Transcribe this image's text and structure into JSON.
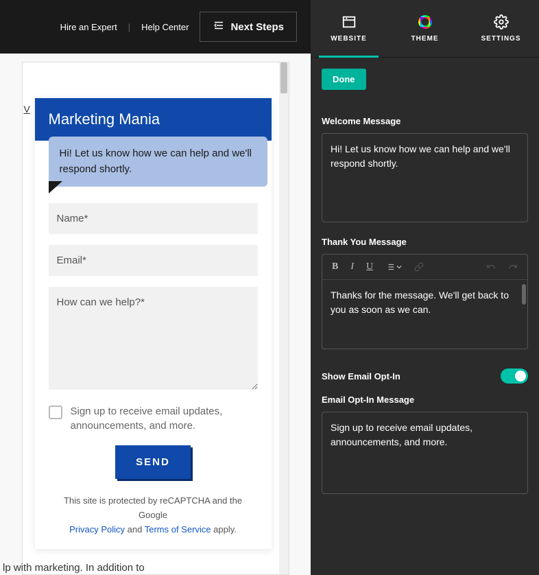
{
  "topbar": {
    "hire_expert": "Hire an Expert",
    "help_center": "Help Center",
    "next_steps": "Next Steps"
  },
  "chat": {
    "title": "Marketing Mania",
    "bubble": "Hi! Let us know how we can help and we'll respond shortly.",
    "name_placeholder": "Name*",
    "email_placeholder": "Email*",
    "message_placeholder": "How can we help?*",
    "optin_text": "Sign up to receive email updates, announcements, and more.",
    "send_label": "SEND",
    "recaptcha_prefix": "This site is protected by reCAPTCHA and the Google",
    "privacy_label": "Privacy Policy",
    "and_text": " and ",
    "terms_label": "Terms of Service",
    "apply_text": " apply."
  },
  "overflow_text": "lp with marketing. In addition to",
  "vtext": "V",
  "panel": {
    "tabs": {
      "website": "WEBSITE",
      "theme": "THEME",
      "settings": "SETTINGS"
    },
    "done_label": "Done",
    "welcome_label": "Welcome Message",
    "welcome_value": "Hi! Let us know how we can help and we'll respond shortly.",
    "thankyou_label": "Thank You Message",
    "thankyou_value": "Thanks for the message. We'll get back to you as soon as we can.",
    "optin_toggle_label": "Show Email Opt-In",
    "optin_msg_label": "Email Opt-In Message",
    "optin_msg_value": "Sign up to receive email updates, announcements, and more."
  }
}
